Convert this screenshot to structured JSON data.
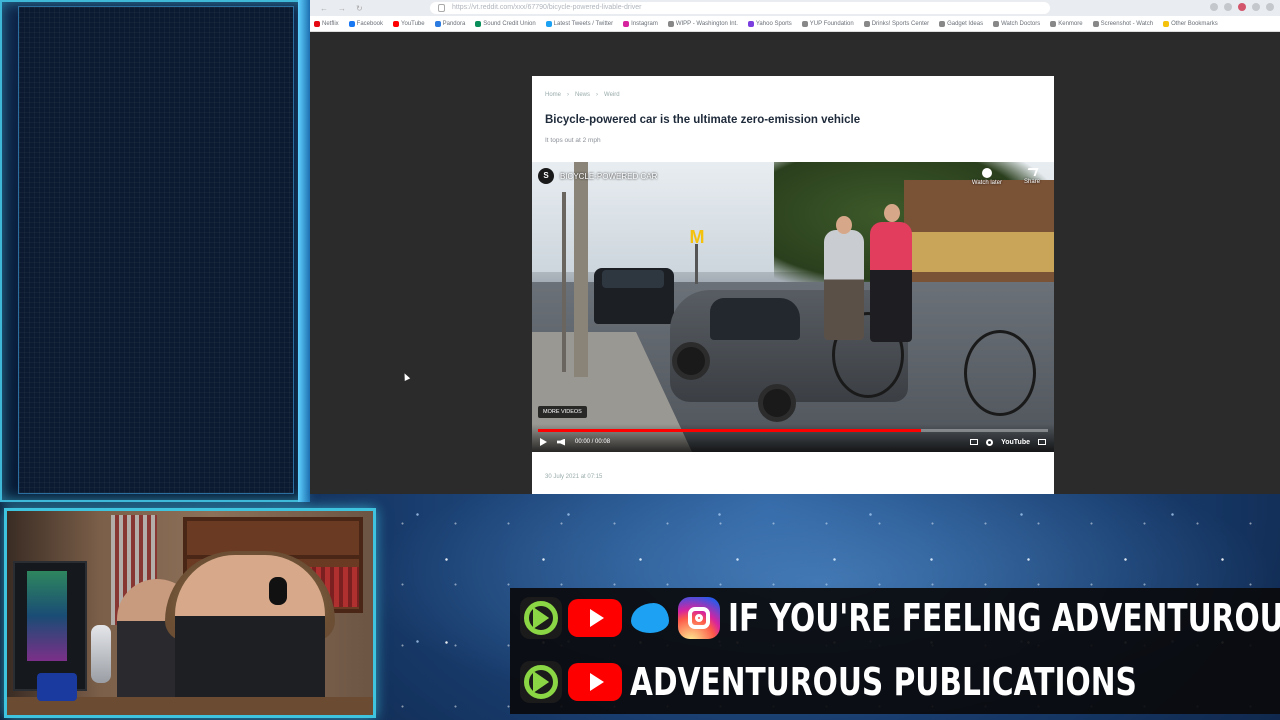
{
  "browser": {
    "address": "https://vt.reddit.com/xxx/67790/bicycle-powered-livable-driver",
    "bookmarks": [
      "Netflix",
      "Facebook",
      "YouTube",
      "Pandora",
      "Sound Credit Union",
      "Latest Tweets / Twitter",
      "Instagram",
      "WIPP - Washington Int.",
      "Yahoo Sports",
      "YUP Foundation",
      "Drinks! Sports Center",
      "Gadget Ideas",
      "Watch Doctors",
      "Kenmore",
      "Screenshot - Watch",
      "Other Bookmarks"
    ]
  },
  "article": {
    "breadcrumbs": [
      "Home",
      "News",
      "Weird"
    ],
    "headline": "Bicycle-powered car is the ultimate zero-emission vehicle",
    "subhead": "It tops out at 2 mph",
    "dateline": "30 July 2021 at 07:15"
  },
  "video": {
    "channel_initial": "S",
    "title": "BICYCLE-POWERED CAR",
    "watch_later_label": "Watch later",
    "share_label": "Share",
    "more_videos_label": "MORE VIDEOS",
    "time": "00:00 / 00:08",
    "progress": 0.75,
    "platform": "YouTube"
  },
  "banner": {
    "row1_text": "IF YOU'RE FEELING ADVENTUROUS",
    "row2_text": "ADVENTUROUS PUBLICATIONS",
    "icons_row1": [
      "rumble-icon",
      "youtube-icon",
      "twitter-icon",
      "instagram-icon"
    ],
    "icons_row2": [
      "rumble-icon",
      "youtube-icon"
    ]
  },
  "colors": {
    "frame_accent": "#3fb8d8",
    "youtube_red": "#ff0000",
    "rumble_green": "#8bd644",
    "twitter_blue": "#1da1f2"
  }
}
